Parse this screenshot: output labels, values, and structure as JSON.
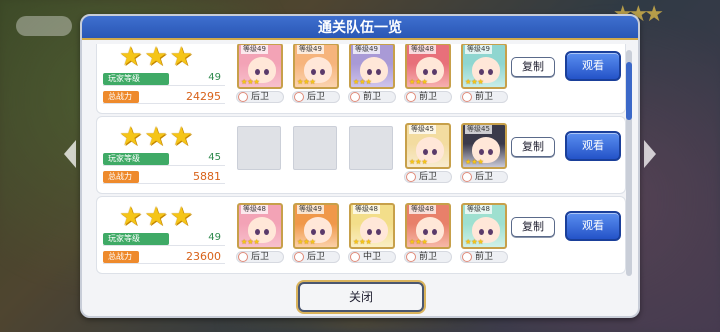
{
  "dialog": {
    "title": "通关队伍一览",
    "close_label": "关闭"
  },
  "labels": {
    "player_level": "玩家等级",
    "total_power": "总战力",
    "copy": "复制",
    "watch": "观看"
  },
  "colors": {
    "header_blue": "#2a57b5",
    "watch_button": "#2453c8",
    "level_tag": "#3faa66",
    "power_tag": "#ee8a2c",
    "star": "#f5c518"
  },
  "teams": [
    {
      "stars": 3,
      "player_level": "49",
      "total_power": "24295",
      "members": [
        {
          "level": "等级49",
          "position": "后卫",
          "stars": "★★★",
          "hair": "#f3a3b6",
          "bg": "#f7c0cc"
        },
        {
          "level": "等级49",
          "position": "后卫",
          "stars": "★★★",
          "hair": "#f6b47c",
          "bg": "#fbd3b0"
        },
        {
          "level": "等级49",
          "position": "前卫",
          "stars": "★★★",
          "hair": "#a99ad6",
          "bg": "#cfc4ec"
        },
        {
          "level": "等级48",
          "position": "前卫",
          "stars": "★★★",
          "hair": "#e8707a",
          "bg": "#f6b0b0"
        },
        {
          "level": "等级49",
          "position": "前卫",
          "stars": "★★★",
          "hair": "#8fd6d0",
          "bg": "#c8ece8"
        }
      ]
    },
    {
      "stars": 3,
      "player_level": "45",
      "total_power": "5881",
      "empty_slots": 3,
      "members": [
        {
          "level": "等级45",
          "position": "后卫",
          "stars": "★★★",
          "hair": "#f3dca0",
          "bg": "#f8ebd0"
        },
        {
          "level": "等级45",
          "position": "后卫",
          "stars": "★★★",
          "hair": "#3a3a4a",
          "bg": "#c9c9d8"
        }
      ]
    },
    {
      "stars": 3,
      "player_level": "49",
      "total_power": "23600",
      "members": [
        {
          "level": "等级48",
          "position": "后卫",
          "stars": "★★★",
          "hair": "#f3a3b6",
          "bg": "#f7c0cc"
        },
        {
          "level": "等级49",
          "position": "后卫",
          "stars": "★★★",
          "hair": "#f0984a",
          "bg": "#fbd0a8"
        },
        {
          "level": "等级48",
          "position": "中卫",
          "stars": "★★★",
          "hair": "#f3de8a",
          "bg": "#faeec4"
        },
        {
          "level": "等级48",
          "position": "前卫",
          "stars": "★★★",
          "hair": "#e8806a",
          "bg": "#f6b8a8"
        },
        {
          "level": "等级48",
          "position": "前卫",
          "stars": "★★★",
          "hair": "#9ee0d0",
          "bg": "#d0f0e8"
        }
      ]
    }
  ]
}
